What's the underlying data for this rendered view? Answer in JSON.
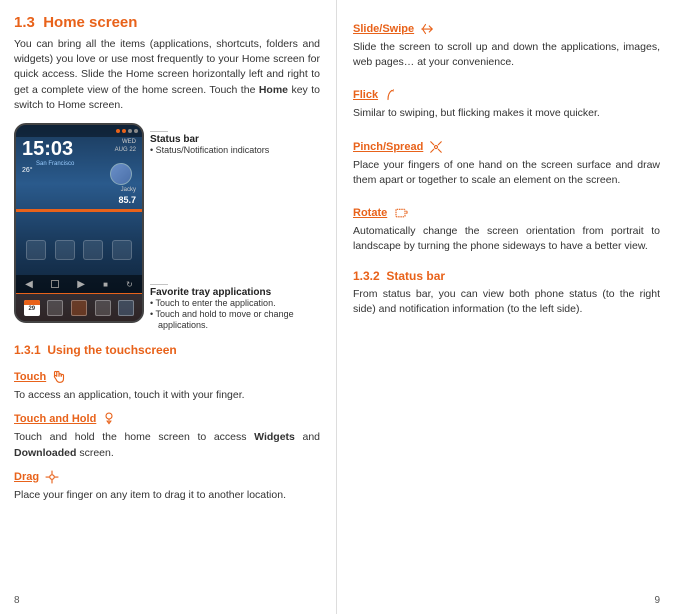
{
  "left": {
    "page_number": "8",
    "section": {
      "num": "1.3",
      "title": "Home screen",
      "body": "You can bring all the items (applications, shortcuts, folders and widgets) you love or use most frequently to your Home screen for quick access. Slide the Home screen horizontally left and right to get a complete view of the home screen. Touch the Home key to switch to Home screen."
    },
    "phone": {
      "time": "15:03",
      "date_line1": "WED",
      "date_line2": "AUG 22",
      "weather": "26°",
      "city": "San Francisco",
      "contact": "Jacky",
      "number": "85.7",
      "calendar_num": "29"
    },
    "status_callout": {
      "title": "Status bar",
      "bullet": "Status/Notification indicators"
    },
    "tray_callout": {
      "title": "Favorite tray applications",
      "bullets": [
        "Touch to enter the application.",
        "Touch and hold to move or change applications."
      ]
    },
    "subsection": {
      "num": "1.3.1",
      "title": "Using the touchscreen"
    },
    "touch_actions": [
      {
        "id": "touch",
        "title": "Touch",
        "body": "To access an application, touch it with your finger."
      },
      {
        "id": "touch-and-hold",
        "title": "Touch and Hold",
        "body": "Touch and hold the home screen to access Widgets and Downloaded screen.",
        "bold_words": [
          "Widgets",
          "Downloaded"
        ]
      },
      {
        "id": "drag",
        "title": "Drag",
        "body": "Place your finger on any item to drag it to another location."
      }
    ]
  },
  "right": {
    "page_number": "9",
    "touch_actions": [
      {
        "id": "slide-swipe",
        "title": "Slide/Swipe",
        "body": "Slide the screen to scroll up and down the applications, images, web pages… at your convenience."
      },
      {
        "id": "flick",
        "title": "Flick",
        "body": "Similar to swiping, but flicking makes it move quicker."
      },
      {
        "id": "pinch-spread",
        "title": "Pinch/Spread",
        "body": "Place your fingers of one hand on the screen surface and draw them apart or together to scale an element on the screen."
      },
      {
        "id": "rotate",
        "title": "Rotate",
        "body": "Automatically change the screen orientation from portrait to landscape by turning the phone sideways to have a better view."
      }
    ],
    "status_bar_section": {
      "num": "1.3.2",
      "title": "Status bar",
      "body": "From status bar, you can view both phone status (to the right side) and notification information (to the left side)."
    }
  }
}
